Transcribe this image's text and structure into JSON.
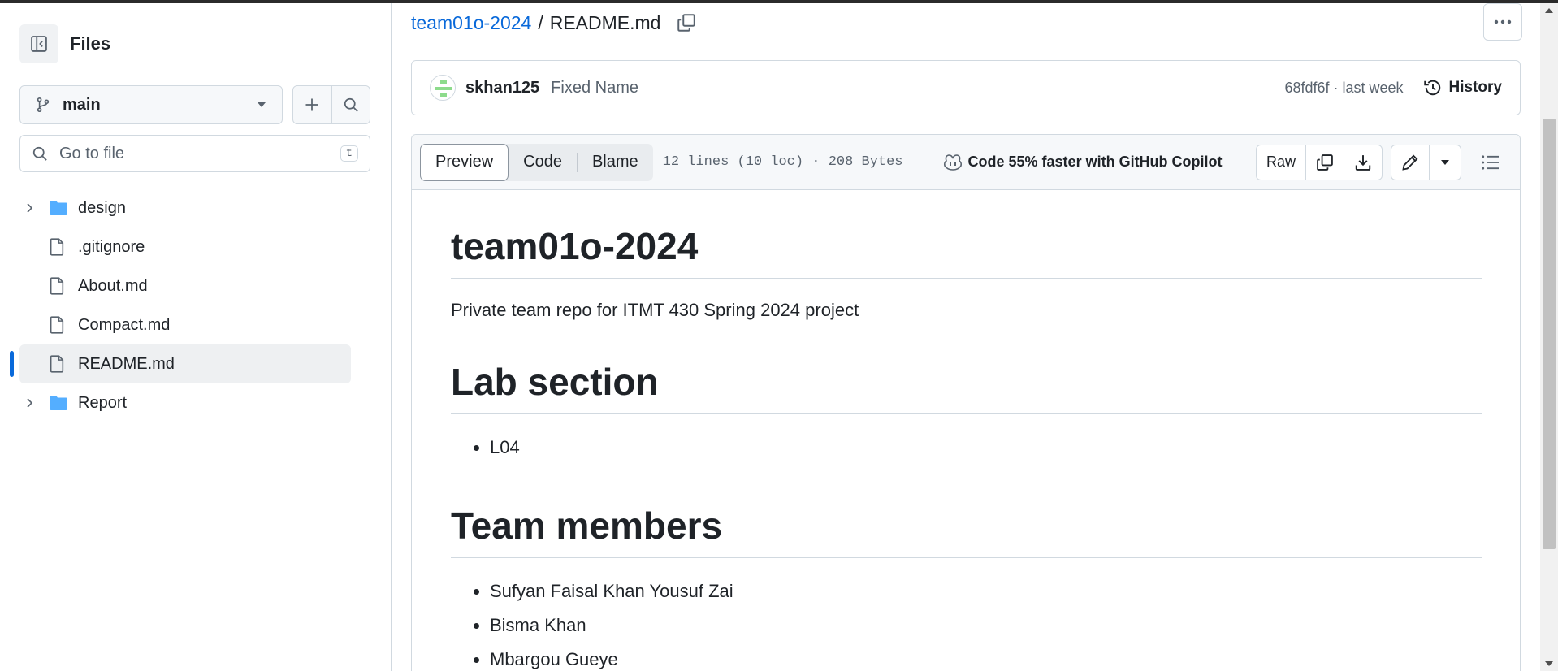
{
  "sidebar": {
    "title": "Files",
    "branch": "main",
    "search_placeholder": "Go to file",
    "search_shortcut": "t",
    "tree": [
      {
        "type": "folder",
        "label": "design"
      },
      {
        "type": "file",
        "label": ".gitignore"
      },
      {
        "type": "file",
        "label": "About.md"
      },
      {
        "type": "file",
        "label": "Compact.md"
      },
      {
        "type": "file",
        "label": "README.md",
        "selected": true
      },
      {
        "type": "folder",
        "label": "Report"
      }
    ]
  },
  "breadcrumb": {
    "repo": "team01o-2024",
    "separator": "/",
    "file": "README.md"
  },
  "commit": {
    "author": "skhan125",
    "message": "Fixed Name",
    "meta": "68fdf6f · last week",
    "history_label": "History"
  },
  "file_toolbar": {
    "tabs": [
      "Preview",
      "Code",
      "Blame"
    ],
    "active_tab": "Preview",
    "info": "12 lines (10 loc) · 208 Bytes",
    "copilot": "Code 55% faster with GitHub Copilot",
    "raw_label": "Raw"
  },
  "readme": {
    "title": "team01o-2024",
    "description": "Private team repo for ITMT 430 Spring 2024 project",
    "section1_heading": "Lab section",
    "section1_items": [
      "L04"
    ],
    "section2_heading": "Team members",
    "section2_items": [
      "Sufyan Faisal Khan Yousuf Zai",
      "Bisma Khan",
      "Mbargou Gueye"
    ]
  },
  "colors": {
    "link": "#0969da",
    "border": "#d1d9e0",
    "folder": "#54aeff",
    "muted": "#59636e",
    "selected_bar": "#0969da"
  }
}
